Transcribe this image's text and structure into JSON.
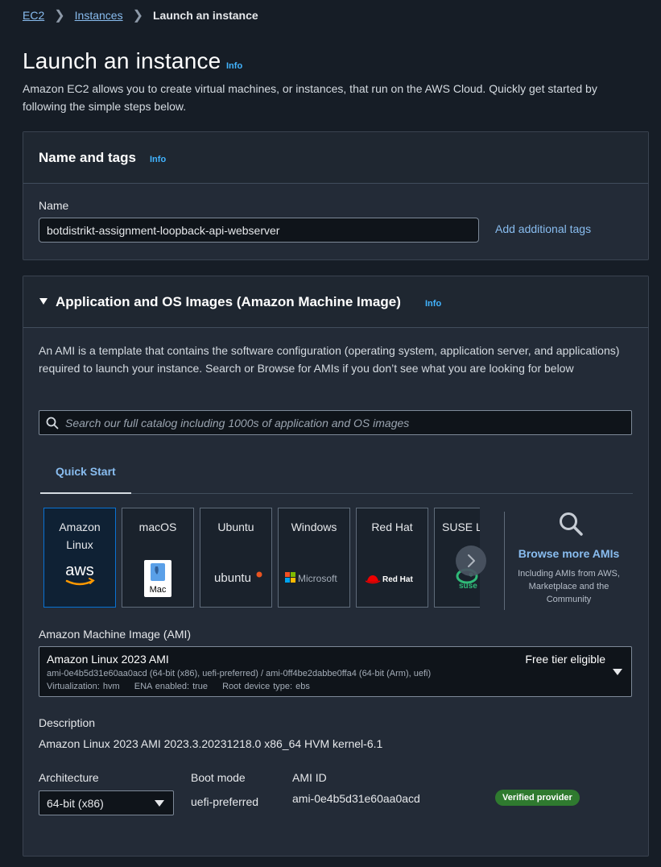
{
  "breadcrumb": {
    "items": [
      "EC2",
      "Instances"
    ],
    "current": "Launch an instance"
  },
  "page": {
    "title": "Launch an instance",
    "info": "Info",
    "intro": "Amazon EC2 allows you to create virtual machines, or instances, that run on the AWS Cloud. Quickly get started by following the simple steps below."
  },
  "name_tags": {
    "title": "Name and tags",
    "info": "Info",
    "name_label": "Name",
    "name_value": "botdistrikt-assignment-loopback-api-webserver",
    "add_tags_link": "Add additional tags"
  },
  "ami_section": {
    "title": "Application and OS Images (Amazon Machine Image)",
    "info": "Info",
    "description": "An AMI is a template that contains the software configuration (operating system, application server, and applications) required to launch your instance. Search or Browse for AMIs if you don’t see what you are looking for below",
    "search_placeholder": "Search our full catalog including 1000s of application and OS images",
    "tab_quick_start": "Quick Start",
    "cards": [
      {
        "name": "Amazon\nLinux",
        "logo": "aws"
      },
      {
        "name": "macOS",
        "logo": "Mac"
      },
      {
        "name": "Ubuntu",
        "logo": "ubuntu"
      },
      {
        "name": "Windows",
        "logo": "Microsoft"
      },
      {
        "name": "Red Hat",
        "logo": "Red Hat"
      },
      {
        "name": "SUSE Li",
        "logo": "suse"
      }
    ],
    "browse_more": "Browse more AMIs",
    "browse_sub": "Including AMIs from AWS, Marketplace and the Community",
    "ami_label": "Amazon Machine Image (AMI)",
    "ami_selected": {
      "title": "Amazon Linux 2023 AMI",
      "ids": "ami-0e4b5d31e60aa0acd (64-bit (x86), uefi-preferred) / ami-0ff4be2dabbe0ffa4 (64-bit (Arm), uefi)",
      "virtualization": "Virtualization: hvm",
      "ena": "ENA enabled: true",
      "root_device": "Root device type: ebs",
      "free_tier": "Free tier eligible"
    },
    "description_label": "Description",
    "description_value": "Amazon Linux 2023 AMI 2023.3.20231218.0 x86_64 HVM kernel-6.1",
    "architecture_label": "Architecture",
    "architecture_value": "64-bit (x86)",
    "boot_mode_label": "Boot mode",
    "boot_mode_value": "uefi-preferred",
    "ami_id_label": "AMI ID",
    "ami_id_value": "ami-0e4b5d31e60aa0acd",
    "verified_badge": "Verified provider"
  },
  "colors": {
    "link": "#89bdf0",
    "info": "#42b4ff",
    "selected_border": "#0972d3",
    "badge_green": "#2f7a2f"
  }
}
